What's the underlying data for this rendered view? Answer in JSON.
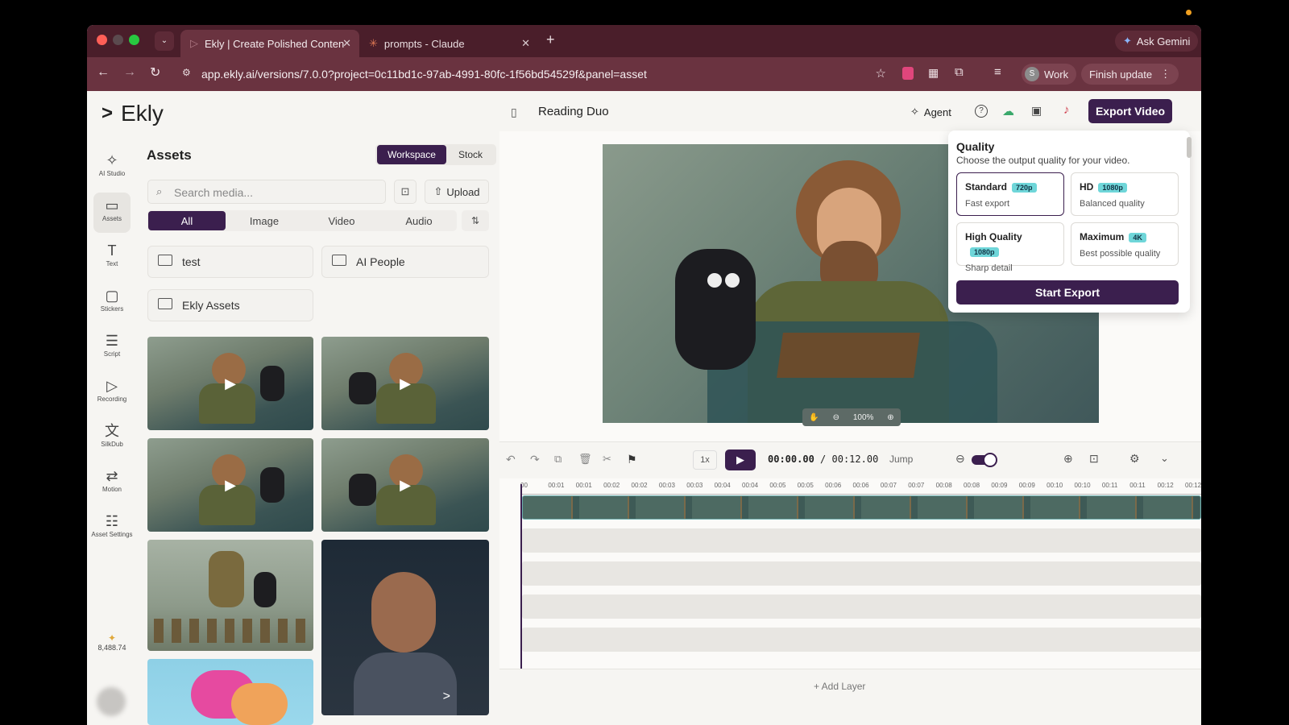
{
  "browser": {
    "tabs": [
      {
        "label": "Ekly | Create Polished Conten",
        "active": true
      },
      {
        "label": "prompts - Claude",
        "active": false
      }
    ],
    "new_tab": "+",
    "url": "app.ekly.ai/versions/7.0.0?project=0c11bd1c-97ab-4991-80fc-1f56bd54529f&panel=asset",
    "ask_gemini": "Ask Gemini",
    "profile_initial": "S",
    "profile_label": "Work",
    "finish_update": "Finish update"
  },
  "app": {
    "logo": "Ekly",
    "project_title": "Reading Duo",
    "agent_label": "Agent",
    "export_button": "Export Video",
    "credits": "8,488.74"
  },
  "rail": [
    {
      "label": "AI Studio",
      "icon": "sparkle-icon",
      "glyph": "✧"
    },
    {
      "label": "Assets",
      "icon": "folder-icon",
      "glyph": "▭"
    },
    {
      "label": "Text",
      "icon": "text-icon",
      "glyph": "T"
    },
    {
      "label": "Stickers",
      "icon": "sticker-icon",
      "glyph": "▢"
    },
    {
      "label": "Script",
      "icon": "script-icon",
      "glyph": "☰"
    },
    {
      "label": "Recording",
      "icon": "record-icon",
      "glyph": "▷"
    },
    {
      "label": "SilkDub",
      "icon": "translate-icon",
      "glyph": "文"
    },
    {
      "label": "Motion",
      "icon": "motion-icon",
      "glyph": "⇄"
    },
    {
      "label": "Asset Settings",
      "icon": "sliders-icon",
      "glyph": "☷"
    }
  ],
  "assets": {
    "title": "Assets",
    "source_tabs": [
      "Workspace",
      "Stock"
    ],
    "search_placeholder": "Search media...",
    "upload_label": "Upload",
    "filters": [
      "All",
      "Image",
      "Video",
      "Audio"
    ],
    "folders": [
      "test",
      "AI People",
      "Ekly Assets"
    ]
  },
  "player": {
    "zoom": "100%"
  },
  "timeline": {
    "speed": "1x",
    "current_time": "00:00.00",
    "total_time": "00:12.00",
    "separator": "/",
    "jump_label": "Jump",
    "ruler": [
      "00",
      "00:01",
      "00:01",
      "00:02",
      "00:02",
      "00:03",
      "00:03",
      "00:04",
      "00:04",
      "00:05",
      "00:05",
      "00:06",
      "00:06",
      "00:07",
      "00:07",
      "00:08",
      "00:08",
      "00:09",
      "00:09",
      "00:10",
      "00:10",
      "00:11",
      "00:11",
      "00:12",
      "00:12"
    ],
    "add_layer": "+ Add Layer"
  },
  "export_popover": {
    "title": "Quality",
    "subtitle": "Choose the output quality for your video.",
    "options": [
      {
        "name": "Standard",
        "badge": "720p",
        "desc": "Fast export",
        "selected": true
      },
      {
        "name": "HD",
        "badge": "1080p",
        "desc": "Balanced quality",
        "selected": false
      },
      {
        "name": "High Quality",
        "badge": "1080p",
        "desc": "Sharp detail",
        "selected": false
      },
      {
        "name": "Maximum",
        "badge": "4K",
        "desc": "Best possible quality",
        "selected": false
      }
    ],
    "start_button": "Start Export"
  },
  "colors": {
    "accent": "#3b1f4e",
    "chrome": "#4a1e2a",
    "badge": "#6fd6d9"
  }
}
